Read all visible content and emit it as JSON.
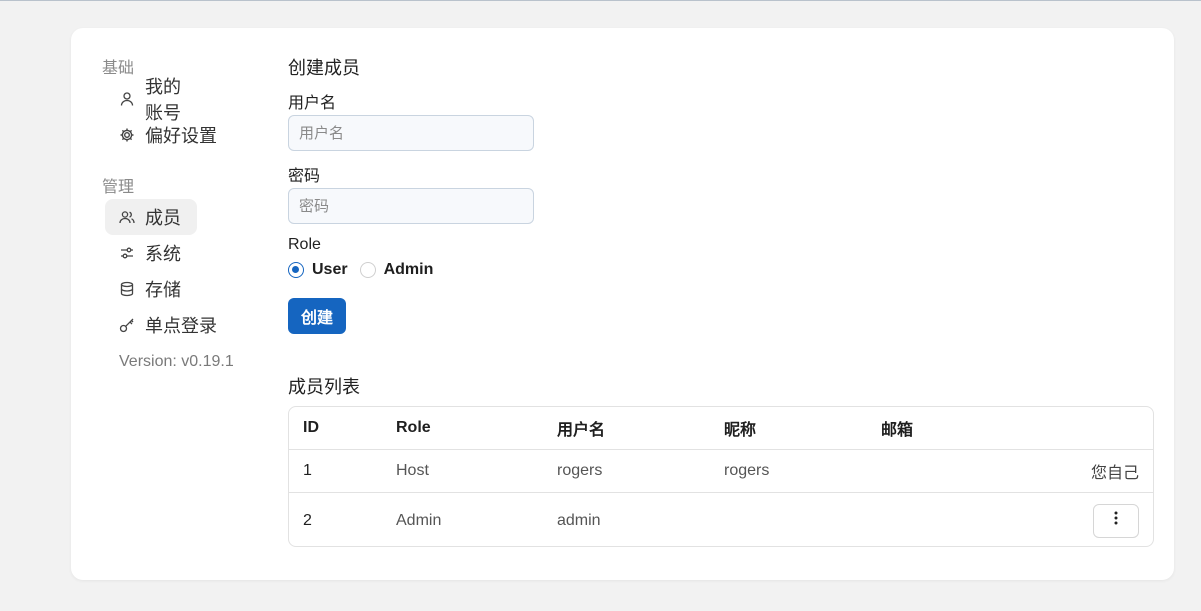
{
  "sidebar": {
    "sections": [
      {
        "title": "基础",
        "items": [
          {
            "label": "我的账号",
            "icon": "user-icon",
            "active": false
          },
          {
            "label": "偏好设置",
            "icon": "gear-icon",
            "active": false
          }
        ]
      },
      {
        "title": "管理",
        "items": [
          {
            "label": "成员",
            "icon": "users-icon",
            "active": true
          },
          {
            "label": "系统",
            "icon": "sliders-icon",
            "active": false
          },
          {
            "label": "存储",
            "icon": "database-icon",
            "active": false
          },
          {
            "label": "单点登录",
            "icon": "key-icon",
            "active": false
          }
        ]
      }
    ],
    "version": "Version: v0.19.1"
  },
  "form": {
    "heading": "创建成员",
    "username_label": "用户名",
    "username_placeholder": "用户名",
    "username_value": "",
    "password_label": "密码",
    "password_placeholder": "密码",
    "password_value": "",
    "role_label": "Role",
    "role_options": [
      "User",
      "Admin"
    ],
    "role_selected": "User",
    "create_label": "创建"
  },
  "members": {
    "heading": "成员列表",
    "columns": [
      "ID",
      "Role",
      "用户名",
      "昵称",
      "邮箱"
    ],
    "rows": [
      {
        "id": "1",
        "role": "Host",
        "username": "rogers",
        "nickname": "rogers",
        "email": "",
        "action": "您自己"
      },
      {
        "id": "2",
        "role": "Admin",
        "username": "admin",
        "nickname": "",
        "email": "",
        "action": "more-menu"
      }
    ]
  },
  "colors": {
    "accent": "#1565c0",
    "background": "#f2f2f2",
    "card": "#ffffff"
  }
}
